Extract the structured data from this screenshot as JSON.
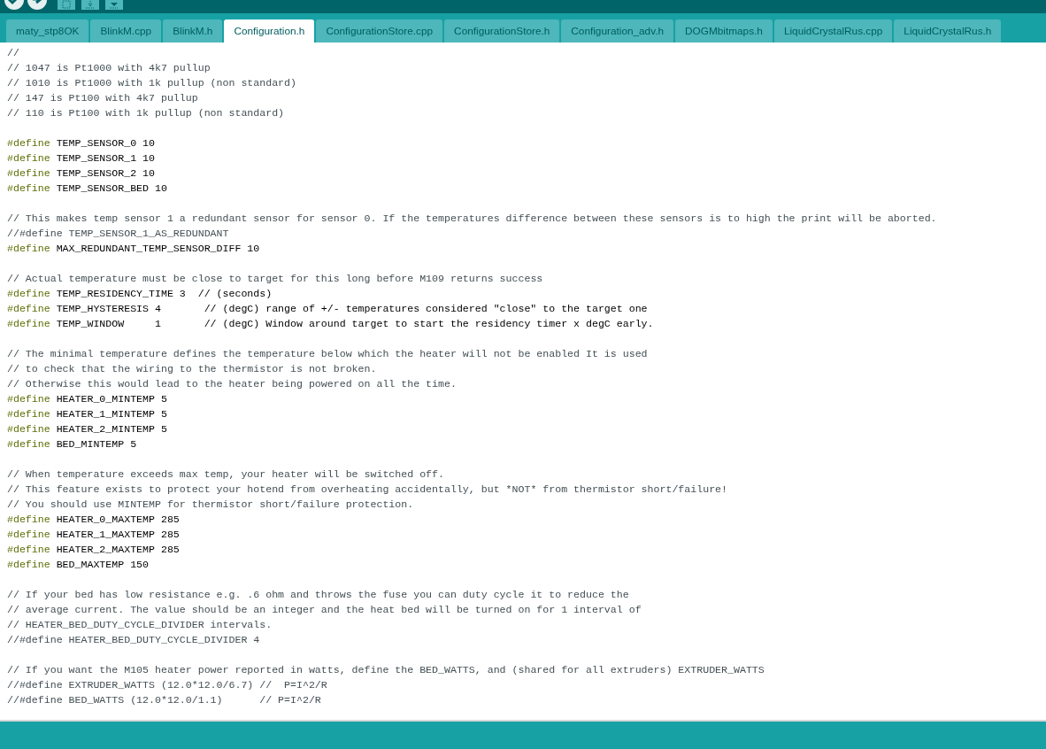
{
  "tabs": [
    {
      "label": "maty_stp8OK",
      "selected": false
    },
    {
      "label": "BlinkM.cpp",
      "selected": false
    },
    {
      "label": "BlinkM.h",
      "selected": false
    },
    {
      "label": "Configuration.h",
      "selected": true
    },
    {
      "label": "ConfigurationStore.cpp",
      "selected": false
    },
    {
      "label": "ConfigurationStore.h",
      "selected": false
    },
    {
      "label": "Configuration_adv.h",
      "selected": false
    },
    {
      "label": "DOGMbitmaps.h",
      "selected": false
    },
    {
      "label": "LiquidCrystalRus.cpp",
      "selected": false
    },
    {
      "label": "LiquidCrystalRus.h",
      "selected": false
    }
  ],
  "editor": {
    "lines": [
      {
        "kind": "comment",
        "text": "//"
      },
      {
        "kind": "comment",
        "text": "// 1047 is Pt1000 with 4k7 pullup"
      },
      {
        "kind": "comment",
        "text": "// 1010 is Pt1000 with 1k pullup (non standard)"
      },
      {
        "kind": "comment",
        "text": "// 147 is Pt100 with 4k7 pullup"
      },
      {
        "kind": "comment",
        "text": "// 110 is Pt100 with 1k pullup (non standard)"
      },
      {
        "kind": "blank"
      },
      {
        "kind": "define",
        "keyword": "#define",
        "text": "TEMP_SENSOR_0 10"
      },
      {
        "kind": "define",
        "keyword": "#define",
        "text": "TEMP_SENSOR_1 10"
      },
      {
        "kind": "define",
        "keyword": "#define",
        "text": "TEMP_SENSOR_2 10"
      },
      {
        "kind": "define",
        "keyword": "#define",
        "text": "TEMP_SENSOR_BED 10"
      },
      {
        "kind": "blank"
      },
      {
        "kind": "comment",
        "text": "// This makes temp sensor 1 a redundant sensor for sensor 0. If the temperatures difference between these sensors is to high the print will be aborted."
      },
      {
        "kind": "comment",
        "text": "//#define TEMP_SENSOR_1_AS_REDUNDANT"
      },
      {
        "kind": "define",
        "keyword": "#define",
        "text": "MAX_REDUNDANT_TEMP_SENSOR_DIFF 10"
      },
      {
        "kind": "blank"
      },
      {
        "kind": "comment",
        "text": "// Actual temperature must be close to target for this long before M109 returns success"
      },
      {
        "kind": "define",
        "keyword": "#define",
        "text": "TEMP_RESIDENCY_TIME 3  // (seconds)"
      },
      {
        "kind": "define",
        "keyword": "#define",
        "text": "TEMP_HYSTERESIS 4       // (degC) range of +/- temperatures considered \"close\" to the target one"
      },
      {
        "kind": "define",
        "keyword": "#define",
        "text": "TEMP_WINDOW     1       // (degC) Window around target to start the residency timer x degC early."
      },
      {
        "kind": "blank"
      },
      {
        "kind": "comment",
        "text": "// The minimal temperature defines the temperature below which the heater will not be enabled It is used"
      },
      {
        "kind": "comment",
        "text": "// to check that the wiring to the thermistor is not broken."
      },
      {
        "kind": "comment",
        "text": "// Otherwise this would lead to the heater being powered on all the time."
      },
      {
        "kind": "define",
        "keyword": "#define",
        "text": "HEATER_0_MINTEMP 5"
      },
      {
        "kind": "define",
        "keyword": "#define",
        "text": "HEATER_1_MINTEMP 5"
      },
      {
        "kind": "define",
        "keyword": "#define",
        "text": "HEATER_2_MINTEMP 5"
      },
      {
        "kind": "define",
        "keyword": "#define",
        "text": "BED_MINTEMP 5"
      },
      {
        "kind": "blank"
      },
      {
        "kind": "comment",
        "text": "// When temperature exceeds max temp, your heater will be switched off."
      },
      {
        "kind": "comment",
        "text": "// This feature exists to protect your hotend from overheating accidentally, but *NOT* from thermistor short/failure!"
      },
      {
        "kind": "comment",
        "text": "// You should use MINTEMP for thermistor short/failure protection."
      },
      {
        "kind": "define",
        "keyword": "#define",
        "text": "HEATER_0_MAXTEMP 285"
      },
      {
        "kind": "define",
        "keyword": "#define",
        "text": "HEATER_1_MAXTEMP 285"
      },
      {
        "kind": "define",
        "keyword": "#define",
        "text": "HEATER_2_MAXTEMP 285"
      },
      {
        "kind": "define",
        "keyword": "#define",
        "text": "BED_MAXTEMP 150"
      },
      {
        "kind": "blank"
      },
      {
        "kind": "comment",
        "text": "// If your bed has low resistance e.g. .6 ohm and throws the fuse you can duty cycle it to reduce the"
      },
      {
        "kind": "comment",
        "text": "// average current. The value should be an integer and the heat bed will be turned on for 1 interval of"
      },
      {
        "kind": "comment",
        "text": "// HEATER_BED_DUTY_CYCLE_DIVIDER intervals."
      },
      {
        "kind": "comment",
        "text": "//#define HEATER_BED_DUTY_CYCLE_DIVIDER 4"
      },
      {
        "kind": "blank"
      },
      {
        "kind": "comment",
        "text": "// If you want the M105 heater power reported in watts, define the BED_WATTS, and (shared for all extruders) EXTRUDER_WATTS"
      },
      {
        "kind": "comment",
        "text": "//#define EXTRUDER_WATTS (12.0*12.0/6.7) //  P=I^2/R"
      },
      {
        "kind": "comment",
        "text": "//#define BED_WATTS (12.0*12.0/1.1)      // P=I^2/R"
      }
    ]
  }
}
